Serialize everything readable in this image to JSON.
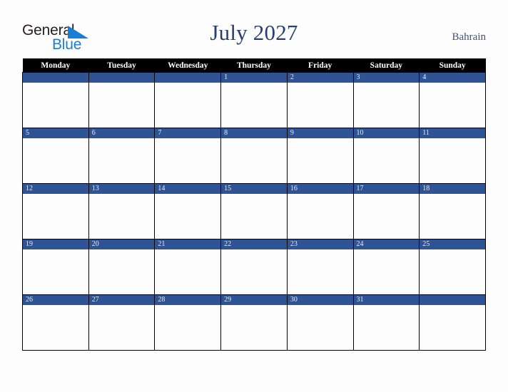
{
  "brand": {
    "word_one": "General",
    "word_two": "Blue",
    "triangle_icon": "triangle-icon",
    "color_dark": "#231f20",
    "color_blue": "#1a7fd4"
  },
  "header": {
    "title": "July 2027",
    "country": "Bahrain",
    "title_color": "#27406e",
    "country_color": "#3d547f"
  },
  "calendar": {
    "weekday_headers": [
      "Monday",
      "Tuesday",
      "Wednesday",
      "Thursday",
      "Friday",
      "Saturday",
      "Sunday"
    ],
    "header_bg": "#000000",
    "header_text": "#ffffff",
    "day_band_bg": "#2e5496",
    "day_number_color": "#e8ecf4",
    "cell_bg": "#fdfdfd",
    "border_color": "#000000",
    "weeks": [
      [
        "",
        "",
        "",
        "1",
        "2",
        "3",
        "4"
      ],
      [
        "5",
        "6",
        "7",
        "8",
        "9",
        "10",
        "11"
      ],
      [
        "12",
        "13",
        "14",
        "15",
        "16",
        "17",
        "18"
      ],
      [
        "19",
        "20",
        "21",
        "22",
        "23",
        "24",
        "25"
      ],
      [
        "26",
        "27",
        "28",
        "29",
        "30",
        "31",
        ""
      ]
    ]
  }
}
